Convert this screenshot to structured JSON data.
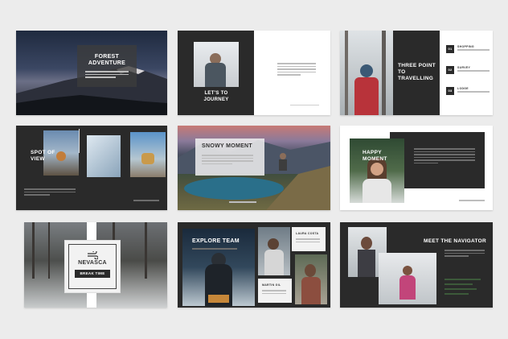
{
  "slides": {
    "s1": {
      "title": "FOREST ADVENTURE"
    },
    "s2": {
      "title": "LET'S TO JOURNEY"
    },
    "s3": {
      "title": "THREE POINT TO TRAVELLING",
      "items": [
        {
          "num": "01",
          "label": "SHOPPING"
        },
        {
          "num": "02",
          "label": "SURVEY"
        },
        {
          "num": "03",
          "label": "LODGE"
        }
      ]
    },
    "s4": {
      "title": "SPOT OF VIEW"
    },
    "s5": {
      "title": "SNOWY MOMENT"
    },
    "s6": {
      "title": "HAPPY MOMENT"
    },
    "s7": {
      "brand": "NEVASCA",
      "subtitle": "BREAK TIME"
    },
    "s8": {
      "title": "EXPLORE TEAM",
      "member1": "LAURA COSTA",
      "member2": "MARTIN GIL"
    },
    "s9": {
      "title": "MEET THE NAVIGATOR"
    }
  },
  "colors": {
    "background": "#ececec",
    "dark": "#2b2b2b",
    "light": "#ffffff",
    "accent": "#3c5a3a"
  }
}
